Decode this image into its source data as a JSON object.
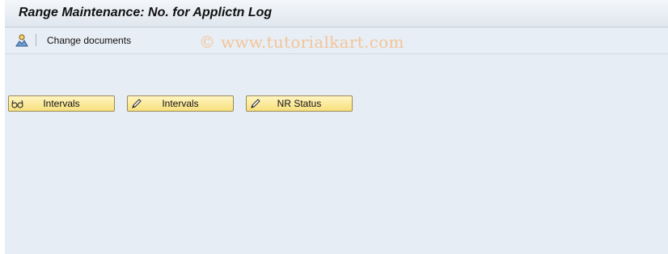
{
  "window": {
    "title": "Range Maintenance: No. for Applictn Log"
  },
  "toolbar": {
    "icon": "person-mountain-icon",
    "change_documents_label": "Change documents"
  },
  "watermark": {
    "text": "© www.tutorialkart.com"
  },
  "buttons": [
    {
      "label": "Intervals",
      "icon": "glasses-icon"
    },
    {
      "label": "Intervals",
      "icon": "pencil-icon"
    },
    {
      "label": "NR Status",
      "icon": "pencil-icon"
    }
  ],
  "colors": {
    "background": "#e6edf4",
    "button_fill": "#f7e07c",
    "watermark": "#f2c59a"
  }
}
